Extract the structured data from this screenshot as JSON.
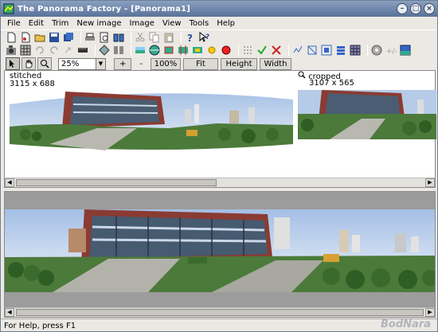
{
  "window": {
    "title": "The Panorama Factory - [Panorama1]"
  },
  "menu": {
    "items": [
      "File",
      "Edit",
      "Trim",
      "New image",
      "Image",
      "View",
      "Tools",
      "Help"
    ]
  },
  "toolbar3": {
    "zoom_value": "25%",
    "plus_label": "+",
    "minus_label": "-",
    "full_label": "100%",
    "fit_label": "Fit",
    "height_label": "Height",
    "width_label": "Width"
  },
  "top_pane": {
    "stitched": {
      "name": "stitched",
      "size": "3115 x 688"
    },
    "cropped": {
      "name": "cropped",
      "size": "3107 x 565"
    }
  },
  "status": {
    "text": "For Help, press F1"
  },
  "watermark": "BodNara",
  "colors": {
    "title_bar": "#5a7299",
    "pane_bg": "#9c9c9c",
    "sky": "#c8d8ee"
  }
}
